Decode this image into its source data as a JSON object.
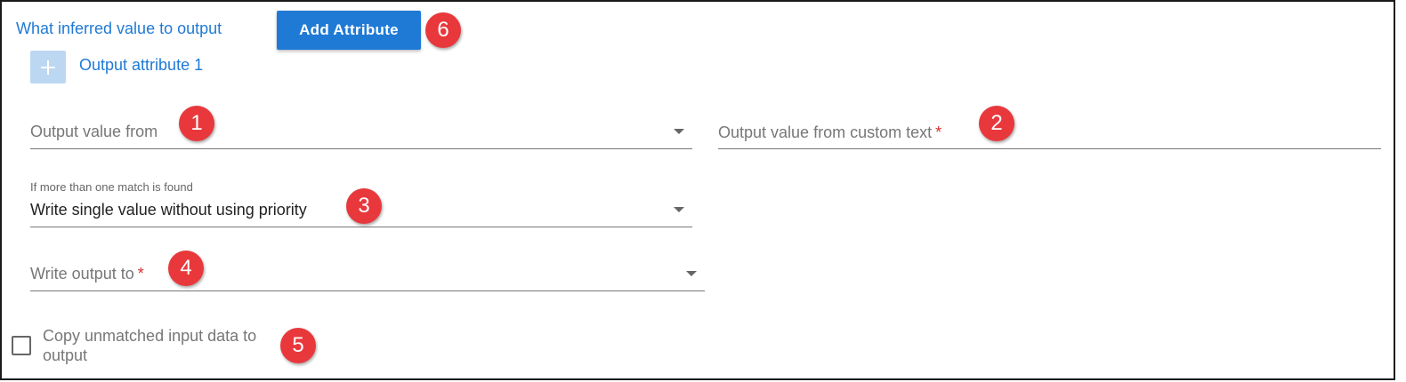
{
  "header": {
    "section_title": "What inferred value to output",
    "add_button_label": "Add Attribute"
  },
  "attribute": {
    "label": "Output attribute 1",
    "plus_icon": "plus-icon"
  },
  "fields": {
    "output_value_from": {
      "placeholder": "Output value from"
    },
    "custom_text": {
      "placeholder": "Output value from custom text",
      "required_mark": "*"
    },
    "priority": {
      "label": "If more than one match is found",
      "value": "Write single value without using priority"
    },
    "write_output": {
      "placeholder": "Write output to",
      "required_mark": "*"
    }
  },
  "checkbox": {
    "label": "Copy unmatched input data to output",
    "checked": false
  },
  "callouts": [
    "1",
    "2",
    "3",
    "4",
    "5",
    "6"
  ],
  "colors": {
    "accent": "#1f7ad6",
    "callout": "#e8383c",
    "required": "#d32f2f"
  }
}
